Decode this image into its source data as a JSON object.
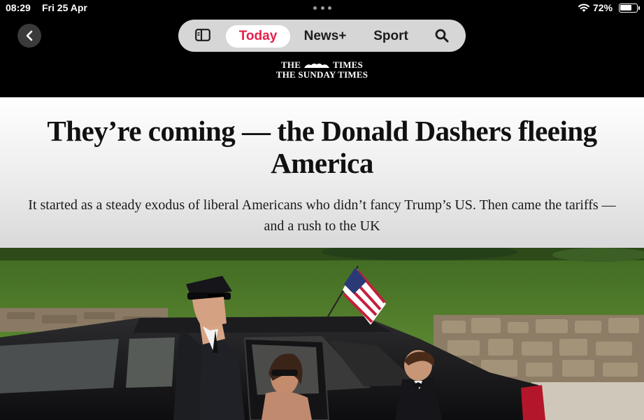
{
  "status_bar": {
    "time": "08:29",
    "date": "Fri 25 Apr",
    "battery": "72%",
    "battery_level": 0.72
  },
  "nav": {
    "tabs": [
      {
        "label": "Today",
        "active": true
      },
      {
        "label": "News+",
        "active": false
      },
      {
        "label": "Sport",
        "active": false
      }
    ],
    "accent_color": "#e5204a"
  },
  "publisher": {
    "line1_left": "THE",
    "line1_right": "TIMES",
    "line2": "THE SUNDAY TIMES"
  },
  "article": {
    "headline": "They’re coming — the Donald Dashers fleeing America",
    "standfirst": "It started as a steady exodus of liberal Americans who didn’t fancy Trump’s US. Then came the tariffs — and a rush to the UK"
  },
  "icons": {
    "back": "chevron-left-icon",
    "sidebar": "sidebar-icon",
    "search": "search-icon",
    "wifi": "wifi-icon",
    "battery": "battery-icon"
  }
}
